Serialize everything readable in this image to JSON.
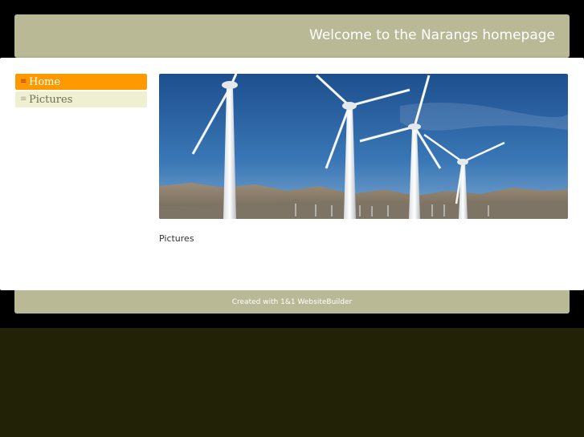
{
  "header": {
    "title": "Welcome to the Narangs homepage"
  },
  "nav": {
    "items": [
      {
        "label": "Home",
        "active": true,
        "icon": "menu-lines-icon"
      },
      {
        "label": "Pictures",
        "active": false,
        "icon": "menu-lines-icon"
      }
    ]
  },
  "main": {
    "hero_image": "wind-turbines-photo",
    "heading": "Pictures"
  },
  "footer": {
    "text": "Created with 1&1 WebsiteBuilder"
  },
  "colors": {
    "background": "#000000",
    "bottom_band": "#222206",
    "header_bar": "#b9b996",
    "nav_active": "#ff9900",
    "nav_inactive": "#efefd1",
    "content_panel": "#ffffff"
  }
}
